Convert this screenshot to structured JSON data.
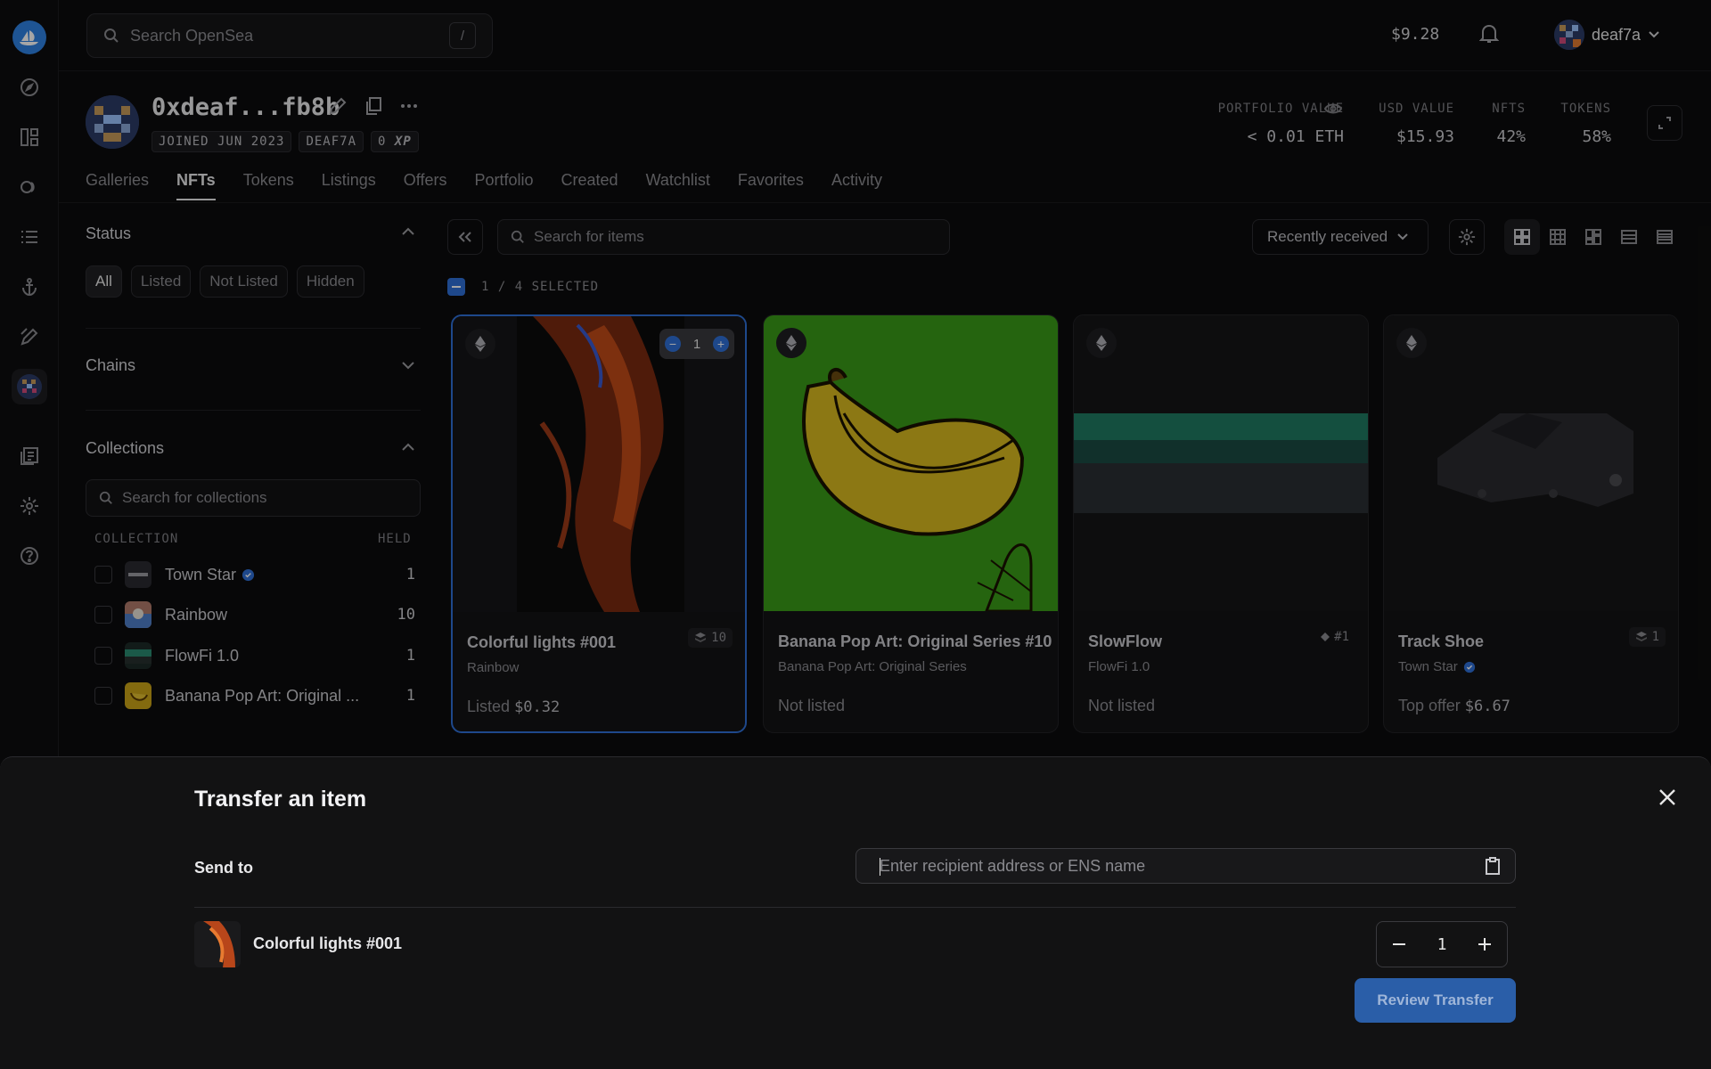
{
  "topbar": {
    "search_placeholder": "Search OpenSea",
    "search_shortcut": "/",
    "balance": "$9.28",
    "username": "deaf7a"
  },
  "profile": {
    "name": "0xdeaf...fb8b",
    "chips": [
      "JOINED JUN 2023",
      "DEAF7A",
      "0"
    ],
    "xp_label": "XP",
    "stats": {
      "portfolio_label": "PORTFOLIO VALUE",
      "portfolio_value": "< 0.01 ETH",
      "usd_label": "USD VALUE",
      "usd_value": "$15.93",
      "nfts_label": "NFTS",
      "nfts_value": "42%",
      "tokens_label": "TOKENS",
      "tokens_value": "58%"
    }
  },
  "tabs": [
    "Galleries",
    "NFTs",
    "Tokens",
    "Listings",
    "Offers",
    "Portfolio",
    "Created",
    "Watchlist",
    "Favorites",
    "Activity"
  ],
  "active_tab": "NFTs",
  "filters": {
    "status_title": "Status",
    "status_options": [
      "All",
      "Listed",
      "Not Listed",
      "Hidden"
    ],
    "chains_title": "Chains",
    "collections_title": "Collections",
    "collections_search_placeholder": "Search for collections",
    "col_header": "COLLECTION",
    "held_header": "HELD",
    "collections": [
      {
        "name": "Town Star",
        "held": "1",
        "verified": true
      },
      {
        "name": "Rainbow",
        "held": "10",
        "verified": false
      },
      {
        "name": "FlowFi 1.0",
        "held": "1",
        "verified": false
      },
      {
        "name": "Banana Pop Art: Original ...",
        "held": "1",
        "verified": false
      }
    ]
  },
  "toolbar": {
    "item_search_placeholder": "Search for items",
    "sort_label": "Recently received",
    "selected_text": "1 / 4 SELECTED"
  },
  "cards": [
    {
      "title": "Colorful lights #001",
      "collection": "Rainbow",
      "price_label": "Listed",
      "price_value": "$0.32",
      "badge": "10",
      "qty": "1"
    },
    {
      "title": "Banana Pop Art: Original Series #10",
      "collection": "Banana Pop Art: Original Series",
      "price_label": "Not listed",
      "price_value": "",
      "badge": ""
    },
    {
      "title": "SlowFlow",
      "collection": "FlowFi 1.0",
      "price_label": "Not listed",
      "price_value": "",
      "badge": "#1"
    },
    {
      "title": "Track Shoe",
      "collection": "Town Star",
      "price_label": "Top offer",
      "price_value": "$6.67",
      "badge": "1"
    }
  ],
  "transfer": {
    "title": "Transfer an item",
    "send_to_label": "Send to",
    "recipient_placeholder": "Enter recipient address or ENS name",
    "item_name": "Colorful lights #001",
    "quantity": "1",
    "review_label": "Review Transfer"
  },
  "colors": {
    "accent": "#2e6fd6",
    "review_button": "#2a5ea8",
    "brand": "#2e81e2"
  }
}
